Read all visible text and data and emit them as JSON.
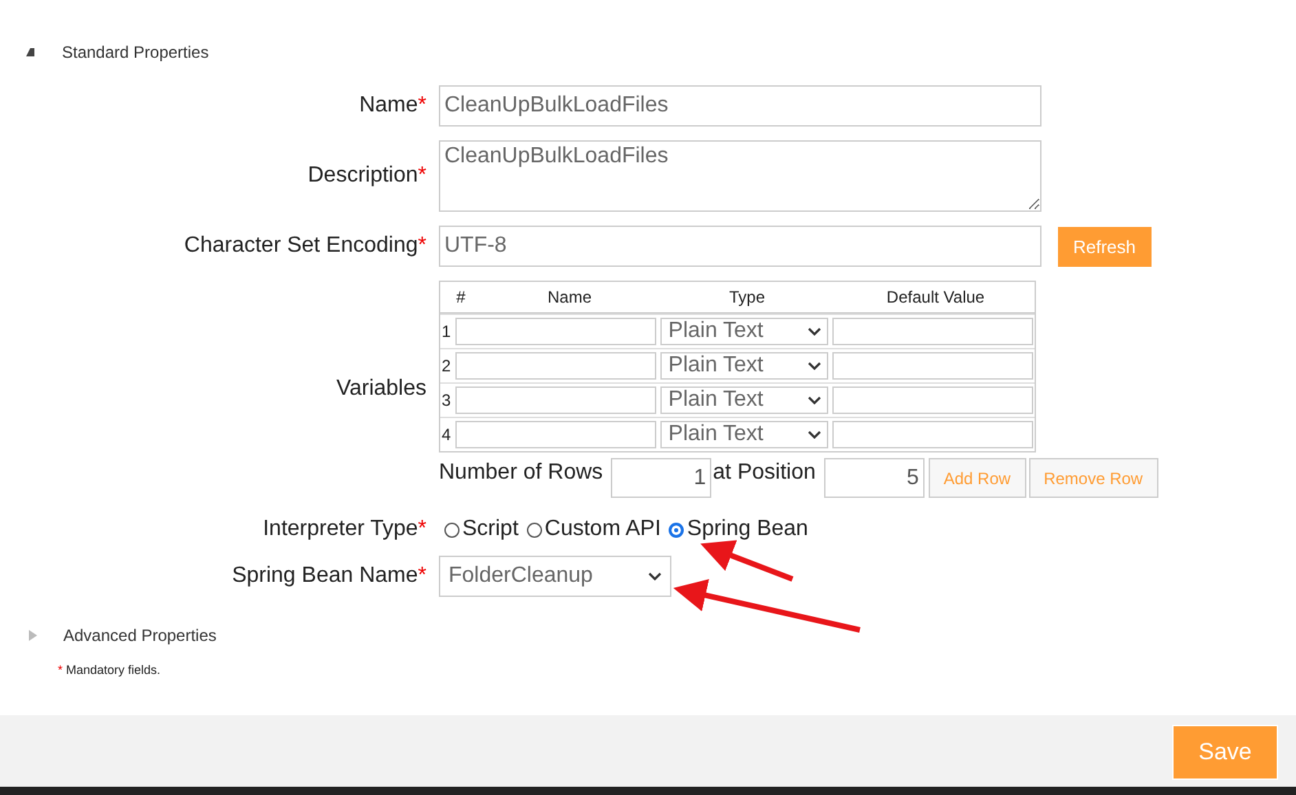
{
  "sections": [
    {
      "title": "Standard Properties",
      "expanded": true
    },
    {
      "title": "Advanced Properties",
      "expanded": false
    }
  ],
  "fields": {
    "name": {
      "label": "Name",
      "value": "CleanUpBulkLoadFiles"
    },
    "description": {
      "label": "Description",
      "value": "CleanUpBulkLoadFiles"
    },
    "encoding": {
      "label": "Character Set Encoding",
      "value": "UTF-8",
      "button": "Refresh"
    }
  },
  "variables": {
    "label": "Variables",
    "columns": [
      "#",
      "Name",
      "Type",
      "Default Value"
    ],
    "rows": [
      {
        "number": "1",
        "type": "Plain Text"
      },
      {
        "number": "2",
        "type": "Plain Text"
      },
      {
        "number": "3",
        "type": "Plain Text"
      },
      {
        "number": "4",
        "type": "Plain Text"
      }
    ],
    "rows_label": "Number of Rows",
    "rows_value": "1",
    "position_label": "at Position",
    "position_value": "5",
    "add_button": "Add Row",
    "remove_button": "Remove Row"
  },
  "interpreter": {
    "label": "Interpreter Type",
    "options": [
      {
        "label": "Script",
        "selected": false
      },
      {
        "label": "Custom API",
        "selected": false
      },
      {
        "label": "Spring Bean",
        "selected": true
      }
    ]
  },
  "spring_bean": {
    "label": "Spring Bean Name",
    "value": "FolderCleanup"
  },
  "required_mark": "*",
  "mandatory_note": "Mandatory fields.",
  "save_button": "Save"
}
